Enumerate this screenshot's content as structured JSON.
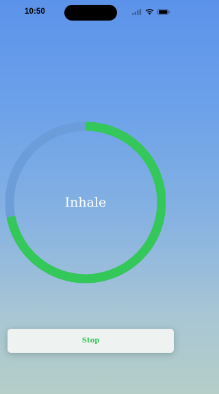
{
  "status_bar": {
    "time": "10:50",
    "icons": [
      "signal-icon",
      "wifi-icon",
      "battery-icon"
    ]
  },
  "breathing": {
    "phase": "Inhale",
    "progress": 0.72,
    "colors": {
      "progress": "#34c759",
      "track": "#6a9bd8"
    }
  },
  "controls": {
    "stop_label": "Stop",
    "stop_color": "#34c759"
  }
}
